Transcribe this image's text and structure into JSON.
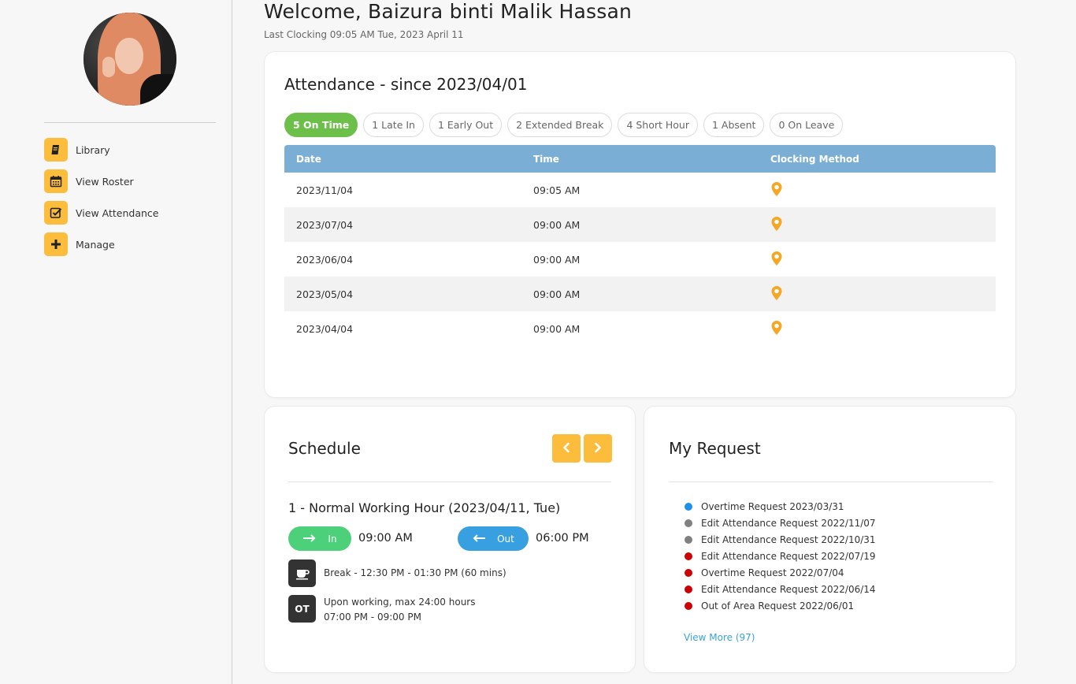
{
  "header": {
    "welcome": "Welcome, Baizura binti Malik Hassan",
    "last_clocking": "Last Clocking 09:05 AM Tue, 2023 April 11"
  },
  "sidebar": {
    "items": [
      {
        "label": "Library",
        "icon": "book-icon"
      },
      {
        "label": "View Roster",
        "icon": "calendar-icon"
      },
      {
        "label": "View Attendance",
        "icon": "checkbox-icon"
      },
      {
        "label": "Manage",
        "icon": "plus-icon"
      }
    ]
  },
  "attendance": {
    "title": "Attendance - since 2023/04/01",
    "filters": [
      "5 On Time",
      "1 Late In",
      "1 Early Out",
      "2 Extended Break",
      "4 Short Hour",
      "1 Absent",
      "0 On Leave"
    ],
    "columns": [
      "Date",
      "Time",
      "Clocking Method"
    ],
    "rows": [
      {
        "date": "2023/11/04",
        "time": "09:05 AM",
        "method": "location-pin-icon"
      },
      {
        "date": "2023/07/04",
        "time": "09:00 AM",
        "method": "location-pin-icon"
      },
      {
        "date": "2023/06/04",
        "time": "09:00 AM",
        "method": "location-pin-icon"
      },
      {
        "date": "2023/05/04",
        "time": "09:00 AM",
        "method": "location-pin-icon"
      },
      {
        "date": "2023/04/04",
        "time": "09:00 AM",
        "method": "location-pin-icon"
      }
    ]
  },
  "schedule": {
    "title": "Schedule",
    "shift_title": "1 - Normal Working Hour (2023/04/11, Tue)",
    "in_label": "In",
    "in_time": "09:00 AM",
    "out_label": "Out",
    "out_time": "06:00 PM",
    "break_text": "Break - 12:30 PM - 01:30 PM (60 mins)",
    "ot_icon_label": "OT",
    "ot_line1": "Upon working, max 24:00 hours",
    "ot_line2": "07:00 PM - 09:00 PM"
  },
  "requests": {
    "title": "My Request",
    "items": [
      {
        "label": "Overtime Request 2023/03/31",
        "color": "#1e90e6"
      },
      {
        "label": "Edit Attendance Request 2022/11/07",
        "color": "#808080"
      },
      {
        "label": "Edit Attendance Request 2022/10/31",
        "color": "#808080"
      },
      {
        "label": "Edit Attendance Request 2022/07/19",
        "color": "#cc0000"
      },
      {
        "label": "Overtime Request 2022/07/04",
        "color": "#cc0000"
      },
      {
        "label": "Edit Attendance Request 2022/06/14",
        "color": "#cc0000"
      },
      {
        "label": "Out of Area Request 2022/06/01",
        "color": "#cc0000"
      }
    ],
    "view_more": "View More (97)"
  },
  "colors": {
    "accent": "#fbbd3b",
    "table_header": "#7aaed4",
    "on_time": "#6cc04a",
    "in": "#4cd17a",
    "out": "#38a0e0",
    "pin": "#f5a623"
  }
}
